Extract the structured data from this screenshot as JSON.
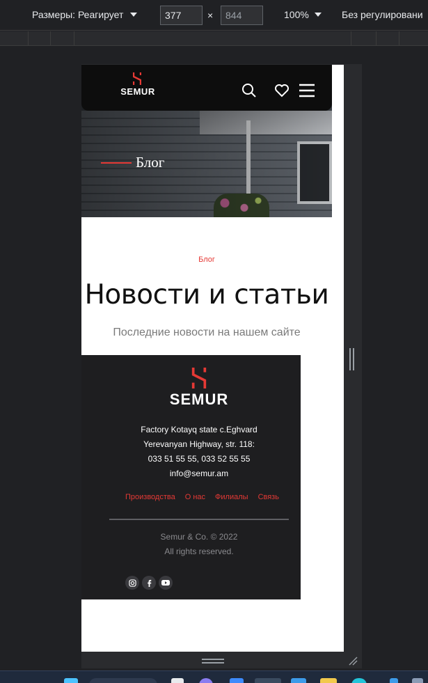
{
  "devtools": {
    "dimensions_label": "Размеры: Реагирует",
    "width_value": "377",
    "height_value": "844",
    "times": "×",
    "zoom": "100%",
    "throttle": "Без регулировани"
  },
  "site": {
    "logo_text": "SEMUR",
    "hero_title": "Блог",
    "section_tag": "Блог",
    "section_title": "Новости и статьи",
    "section_subtitle": "Последние новости на нашем сайте"
  },
  "footer": {
    "logo_text": "SEMUR",
    "address_line1": "Factory Kotayq state c.Eghvard",
    "address_line2": "Yerevanyan Highway, str. 118:",
    "phones": "033 51 55 55, 033 52 55 55",
    "email": "info@semur.am",
    "links": [
      "Производства",
      "О нас",
      "Филиалы",
      "Связь"
    ],
    "copyright": "Semur & Co. © 2022",
    "rights": "All rights reserved.",
    "social_icons": [
      "instagram-icon",
      "facebook-icon",
      "youtube-icon"
    ]
  },
  "colors": {
    "accent": "#e53935",
    "header_bg": "#0d0d0d",
    "footer_bg": "#1e1e20"
  }
}
